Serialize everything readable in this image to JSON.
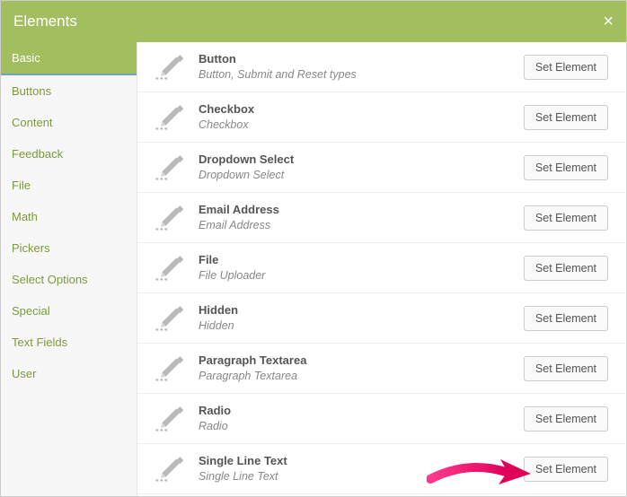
{
  "header": {
    "title": "Elements",
    "close_label": "×"
  },
  "sidebar": {
    "items": [
      {
        "label": "Basic",
        "active": true
      },
      {
        "label": "Buttons",
        "active": false
      },
      {
        "label": "Content",
        "active": false
      },
      {
        "label": "Feedback",
        "active": false
      },
      {
        "label": "File",
        "active": false
      },
      {
        "label": "Math",
        "active": false
      },
      {
        "label": "Pickers",
        "active": false
      },
      {
        "label": "Select Options",
        "active": false
      },
      {
        "label": "Special",
        "active": false
      },
      {
        "label": "Text Fields",
        "active": false
      },
      {
        "label": "User",
        "active": false
      }
    ]
  },
  "elements": [
    {
      "title": "Button",
      "desc": "Button, Submit and Reset types",
      "button": "Set Element"
    },
    {
      "title": "Checkbox",
      "desc": "Checkbox",
      "button": "Set Element"
    },
    {
      "title": "Dropdown Select",
      "desc": "Dropdown Select",
      "button": "Set Element"
    },
    {
      "title": "Email Address",
      "desc": "Email Address",
      "button": "Set Element"
    },
    {
      "title": "File",
      "desc": "File Uploader",
      "button": "Set Element"
    },
    {
      "title": "Hidden",
      "desc": "Hidden",
      "button": "Set Element"
    },
    {
      "title": "Paragraph Textarea",
      "desc": "Paragraph Textarea",
      "button": "Set Element"
    },
    {
      "title": "Radio",
      "desc": "Radio",
      "button": "Set Element"
    },
    {
      "title": "Single Line Text",
      "desc": "Single Line Text",
      "button": "Set Element"
    }
  ]
}
